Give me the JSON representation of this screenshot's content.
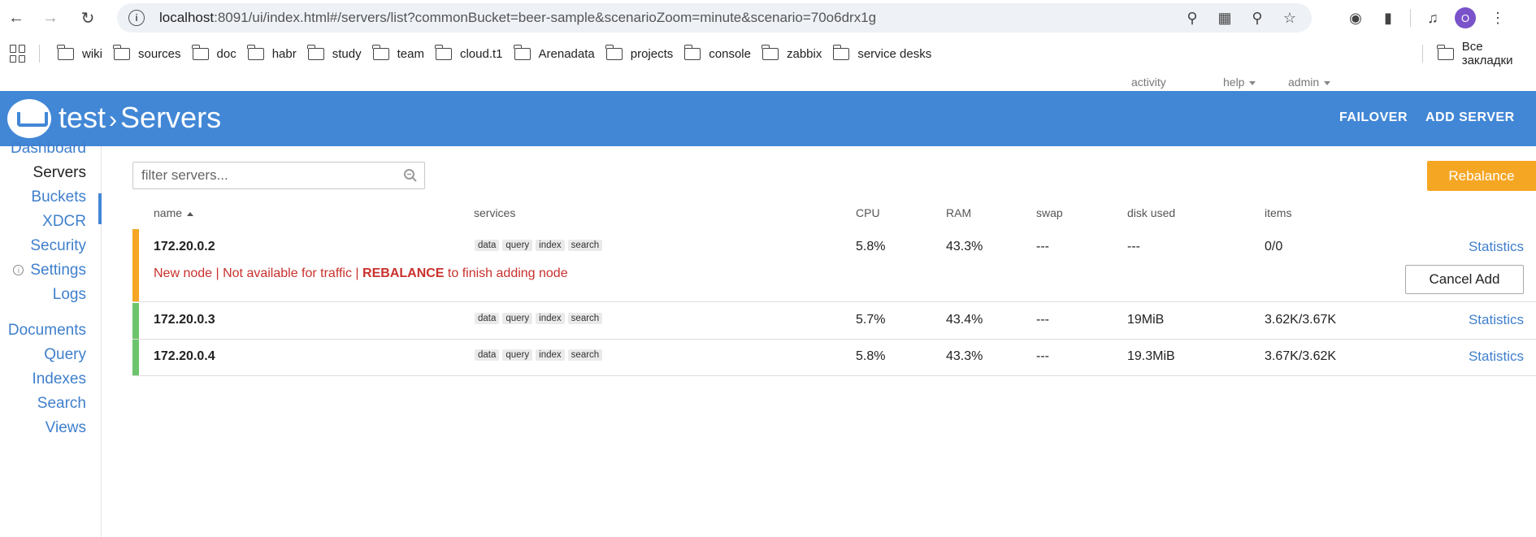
{
  "browser": {
    "url_host": "localhost",
    "url_rest": ":8091/ui/index.html#/servers/list?commonBucket=beer-sample&scenarioZoom=minute&scenario=70o6drx1g",
    "avatar_letter": "O",
    "bookmarks": [
      "wiki",
      "sources",
      "doc",
      "habr",
      "study",
      "team",
      "cloud.t1",
      "Arenadata",
      "projects",
      "console",
      "zabbix",
      "service desks"
    ],
    "all_bookmarks": "Все закладки"
  },
  "topnav": {
    "activity": "activity",
    "help": "help",
    "admin": "admin"
  },
  "header": {
    "cluster": "test",
    "page": "Servers",
    "failover": "FAILOVER",
    "add_server": "ADD SERVER",
    "accent": "#4287d6"
  },
  "sidebar": {
    "items": [
      "Dashboard",
      "Servers",
      "Buckets",
      "XDCR",
      "Security",
      "Settings",
      "Logs",
      "Documents",
      "Query",
      "Indexes",
      "Search",
      "Views"
    ],
    "active": "Servers"
  },
  "filter": {
    "placeholder": "filter servers..."
  },
  "rebalance_label": "Rebalance",
  "columns": {
    "name": "name",
    "services": "services",
    "cpu": "CPU",
    "ram": "RAM",
    "swap": "swap",
    "disk": "disk used",
    "items": "items"
  },
  "services": [
    "data",
    "query",
    "index",
    "search"
  ],
  "servers": [
    {
      "name": "172.20.0.2",
      "cpu": "5.8%",
      "ram": "43.3%",
      "swap": "---",
      "disk": "---",
      "items": "0/0",
      "stats": "Statistics",
      "status_color": "#f5a623"
    },
    {
      "name": "172.20.0.3",
      "cpu": "5.7%",
      "ram": "43.4%",
      "swap": "---",
      "disk": "19MiB",
      "items": "3.62K/3.67K",
      "stats": "Statistics",
      "status_color": "#6cc46c"
    },
    {
      "name": "172.20.0.4",
      "cpu": "5.8%",
      "ram": "43.3%",
      "swap": "---",
      "disk": "19.3MiB",
      "items": "3.67K/3.62K",
      "stats": "Statistics",
      "status_color": "#6cc46c"
    }
  ],
  "pending": {
    "msg_a": "New node | Not available for traffic | ",
    "msg_b": "REBALANCE",
    "msg_c": " to finish adding node",
    "cancel": "Cancel Add"
  }
}
